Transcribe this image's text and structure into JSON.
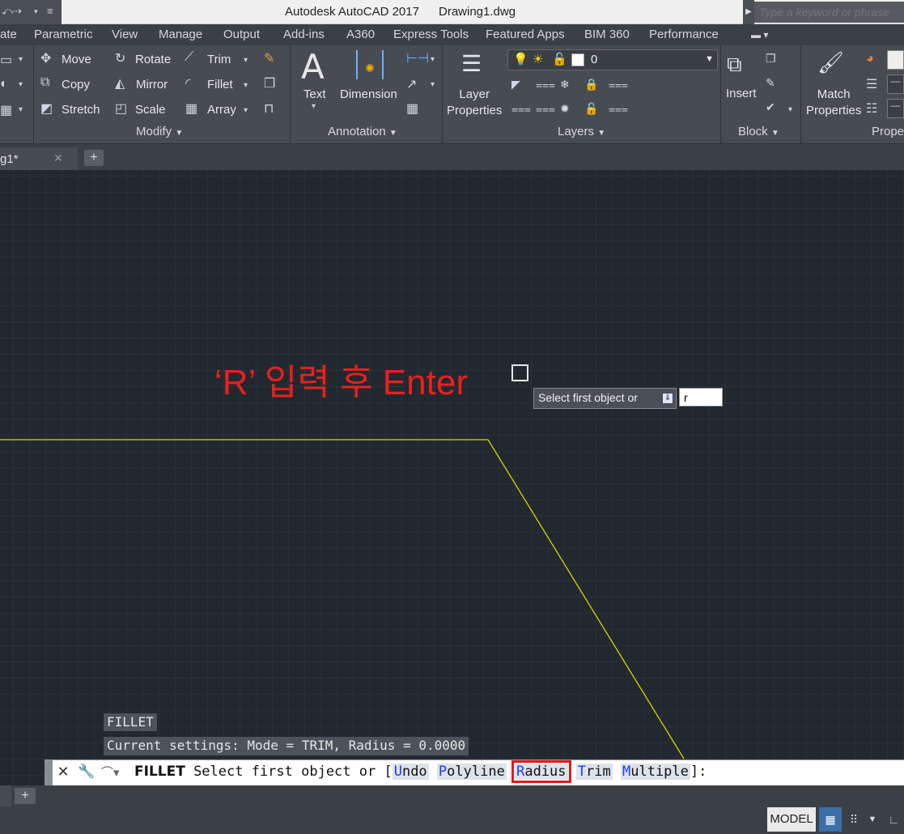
{
  "title_bar": {
    "app_title": "Autodesk AutoCAD 2017",
    "doc_title": "Drawing1.dwg",
    "search_placeholder": "Type a keyword or phrase"
  },
  "menu_tabs": [
    "ate",
    "Parametric",
    "View",
    "Manage",
    "Output",
    "Add-ins",
    "A360",
    "Express Tools",
    "Featured Apps",
    "BIM 360",
    "Performance"
  ],
  "ribbon": {
    "modify": {
      "move": "Move",
      "rotate": "Rotate",
      "trim": "Trim",
      "copy": "Copy",
      "mirror": "Mirror",
      "fillet": "Fillet",
      "stretch": "Stretch",
      "scale": "Scale",
      "array": "Array",
      "panel_title": "Modify"
    },
    "annotation": {
      "text": "Text",
      "dimension": "Dimension",
      "panel_title": "Annotation"
    },
    "layers": {
      "layer_properties": [
        "Layer",
        "Properties"
      ],
      "current_layer": "0",
      "panel_title": "Layers"
    },
    "block": {
      "insert": "Insert",
      "panel_title": "Block"
    },
    "properties": {
      "match_properties": [
        "Match",
        "Properties"
      ],
      "panel_title": "Prope"
    }
  },
  "document_tab": {
    "label": "g1*"
  },
  "canvas": {
    "annotation": "‘R’ 입력 후 Enter",
    "tooltip": "Select first object or",
    "dynamic_input_value": "r",
    "history": [
      "FILLET",
      "Current settings: Mode = TRIM, Radius = 0.0000"
    ]
  },
  "command_line": {
    "command": "FILLET",
    "prompt": "Select first object or [",
    "options": [
      {
        "key": "U",
        "rest": "ndo"
      },
      {
        "key": "P",
        "rest": "olyline"
      },
      {
        "key": "R",
        "rest": "adius",
        "highlighted": true
      },
      {
        "key": "T",
        "rest": "rim"
      },
      {
        "key": "M",
        "rest": "ultiple"
      }
    ],
    "suffix": "]:"
  },
  "status_bar": {
    "model": "MODEL"
  },
  "colors": {
    "polyline": "#d8d400",
    "annotation": "#e8211c",
    "highlight_box": "#e8151b",
    "option_key": "#1a3cff"
  }
}
